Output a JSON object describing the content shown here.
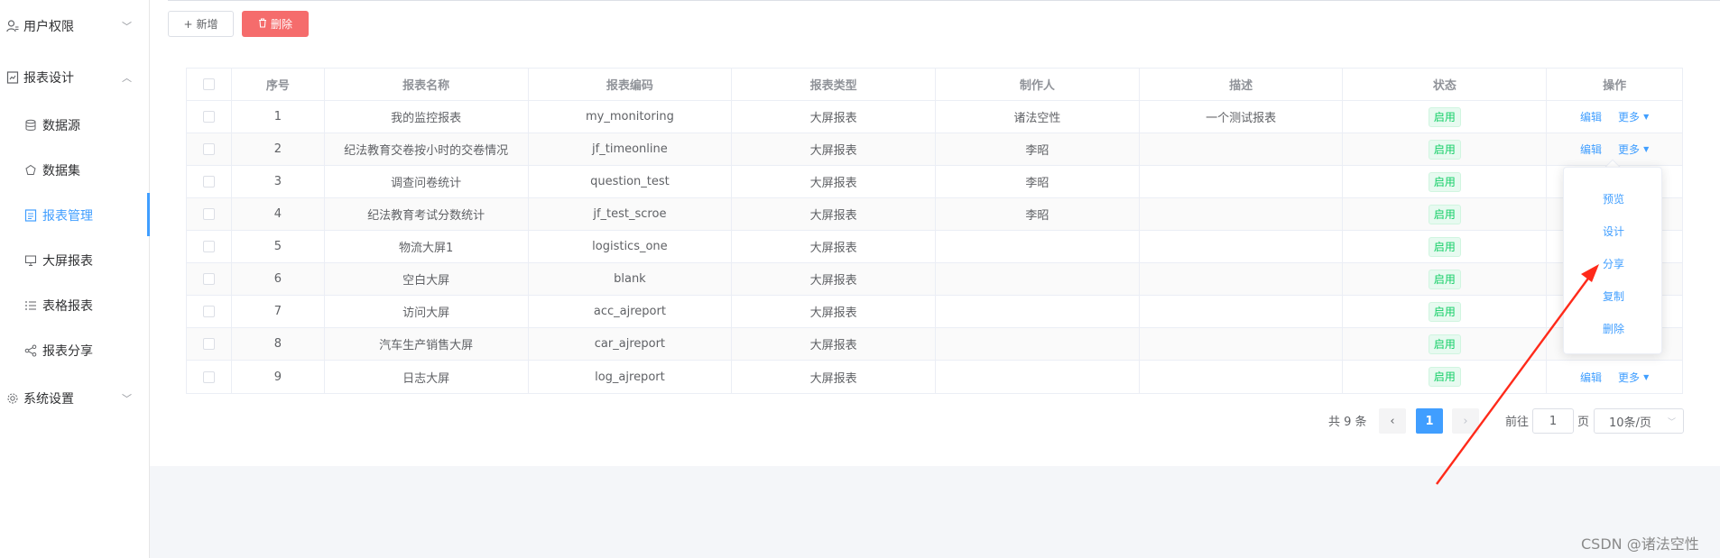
{
  "sidebar": {
    "items": [
      {
        "label": "用户权限",
        "icon": "user-icon",
        "arrow": "chevron-down"
      },
      {
        "label": "报表设计",
        "icon": "report-icon",
        "arrow": "chevron-up"
      },
      {
        "label": "系统设置",
        "icon": "gear-icon",
        "arrow": "chevron-down"
      }
    ],
    "sub_items": [
      {
        "label": "数据源",
        "icon": "database-icon"
      },
      {
        "label": "数据集",
        "icon": "dataset-icon"
      },
      {
        "label": "报表管理",
        "icon": "report-manage-icon",
        "active": true
      },
      {
        "label": "大屏报表",
        "icon": "monitor-icon"
      },
      {
        "label": "表格报表",
        "icon": "list-icon"
      },
      {
        "label": "报表分享",
        "icon": "share-icon"
      }
    ]
  },
  "toolbar": {
    "add_label": "新增",
    "delete_label": "删除"
  },
  "table": {
    "headers": [
      "序号",
      "报表名称",
      "报表编码",
      "报表类型",
      "制作人",
      "描述",
      "状态",
      "操作"
    ],
    "rows": [
      {
        "no": "1",
        "name": "我的监控报表",
        "code": "my_monitoring",
        "type": "大屏报表",
        "author": "诸法空性",
        "desc": "一个测试报表",
        "status": "启用"
      },
      {
        "no": "2",
        "name": "纪法教育交卷按小时的交卷情况",
        "code": "jf_timeonline",
        "type": "大屏报表",
        "author": "李昭",
        "desc": "",
        "status": "启用"
      },
      {
        "no": "3",
        "name": "调查问卷统计",
        "code": "question_test",
        "type": "大屏报表",
        "author": "李昭",
        "desc": "",
        "status": "启用"
      },
      {
        "no": "4",
        "name": "纪法教育考试分数统计",
        "code": "jf_test_scroe",
        "type": "大屏报表",
        "author": "李昭",
        "desc": "",
        "status": "启用"
      },
      {
        "no": "5",
        "name": "物流大屏1",
        "code": "logistics_one",
        "type": "大屏报表",
        "author": "",
        "desc": "",
        "status": "启用"
      },
      {
        "no": "6",
        "name": "空白大屏",
        "code": "blank",
        "type": "大屏报表",
        "author": "",
        "desc": "",
        "status": "启用"
      },
      {
        "no": "7",
        "name": "访问大屏",
        "code": "acc_ajreport",
        "type": "大屏报表",
        "author": "",
        "desc": "",
        "status": "启用"
      },
      {
        "no": "8",
        "name": "汽车生产销售大屏",
        "code": "car_ajreport",
        "type": "大屏报表",
        "author": "",
        "desc": "",
        "status": "启用"
      },
      {
        "no": "9",
        "name": "日志大屏",
        "code": "log_ajreport",
        "type": "大屏报表",
        "author": "",
        "desc": "",
        "status": "启用"
      }
    ],
    "edit_label": "编辑",
    "more_label": "更多"
  },
  "dropdown": {
    "items": [
      "预览",
      "设计",
      "分享",
      "复制",
      "删除"
    ]
  },
  "pagination": {
    "total": "共 9 条",
    "current_page": "1",
    "goto_prefix": "前往",
    "goto_value": "1",
    "goto_suffix": "页",
    "page_size": "10条/页"
  },
  "watermark": "CSDN @诸法空性",
  "colors": {
    "primary": "#409eff",
    "danger": "#f56c6c",
    "success": "#13ce66",
    "annotation": "#ff2a1a"
  }
}
